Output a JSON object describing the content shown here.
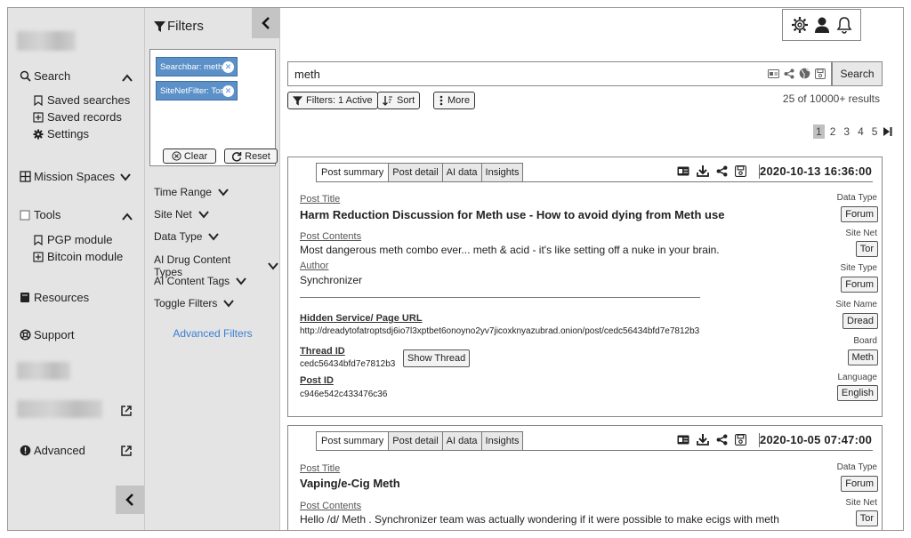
{
  "nav": {
    "search": "Search",
    "saved_searches": "Saved searches",
    "saved_records": "Saved records",
    "settings": "Settings",
    "mission_spaces": "Mission Spaces",
    "tools": "Tools",
    "pgp_module": "PGP module",
    "bitcoin_module": "Bitcoin module",
    "resources": "Resources",
    "support": "Support",
    "advanced": "Advanced"
  },
  "filters": {
    "title": "Filters",
    "chips": [
      "Searchbar: meth",
      "SiteNetFilter: Tor"
    ],
    "clear": "Clear",
    "reset": "Reset",
    "items": [
      "Time Range",
      "Site Net",
      "Data Type",
      "AI Drug Content Types",
      "AI Content Tags",
      "Toggle Filters"
    ],
    "advanced": "Advanced Filters"
  },
  "search": {
    "value": "meth",
    "button": "Search",
    "filters_active": "Filters: 1 Active",
    "sort": "Sort",
    "more": "More",
    "results": "25 of 10000+ results",
    "pages": [
      "1",
      "2",
      "3",
      "4",
      "5"
    ],
    "current_page": "1"
  },
  "tabs": [
    "Post summary",
    "Post detail",
    "AI data",
    "Insights"
  ],
  "labels": {
    "post_title": "Post Title",
    "post_contents": "Post Contents",
    "author": "Author",
    "hidden_url": "Hidden Service/ Page URL",
    "thread_id": "Thread ID",
    "show_thread": "Show Thread",
    "post_id": "Post ID",
    "data_type": "Data Type",
    "site_net": "Site Net",
    "site_type": "Site Type",
    "site_name": "Site Name",
    "board": "Board",
    "language": "Language"
  },
  "results": [
    {
      "date": "2020-10-13 16:36:00",
      "title": "Harm Reduction Discussion for Meth use - How to avoid dying from Meth use",
      "contents": "Most dangerous meth combo ever... meth & acid - it's like setting off a nuke in your brain.",
      "author": "Synchronizer",
      "url": "http://dreadytofatroptsdj6io7l3xptbet6onoyno2yv7jicoxknyazubrad.onion/post/cedc56434bfd7e7812b3",
      "thread_id": "cedc56434bfd7e7812b3",
      "post_id": "c946e542c433476c36",
      "data_type": "Forum",
      "site_net": "Tor",
      "site_type": "Forum",
      "site_name": "Dread",
      "board": "Meth",
      "language": "English"
    },
    {
      "date": "2020-10-05 07:47:00",
      "title": "Vaping/e-Cig Meth",
      "contents": "Hello /d/ Meth . Synchronizer team was actually wondering if it were possible to make ecigs with meth",
      "data_type": "Forum",
      "site_net": "Tor"
    }
  ]
}
